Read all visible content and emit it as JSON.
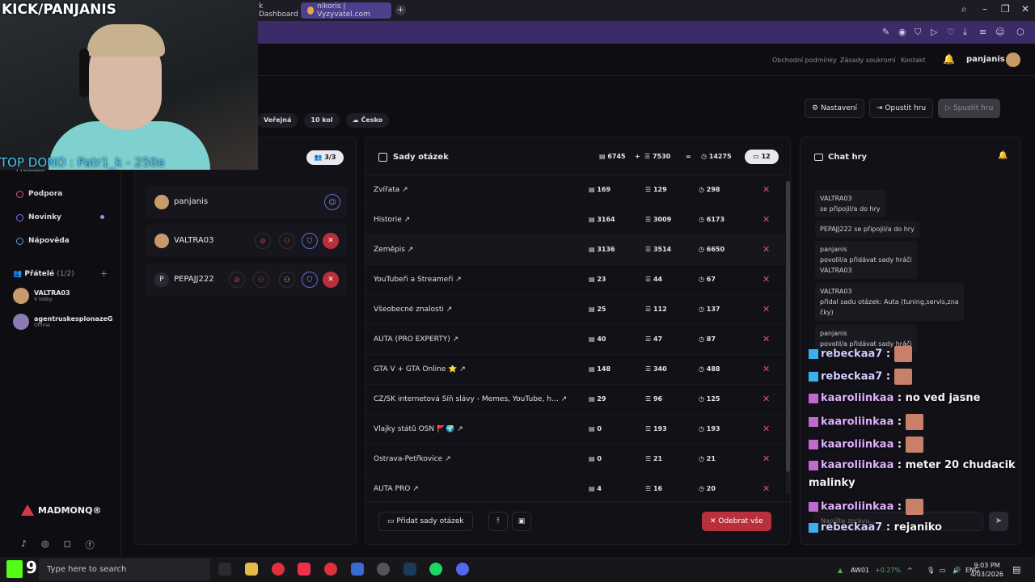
{
  "browser": {
    "tab1": "k Dashboard",
    "tab2": "nikoris | Vyzyvatel.com",
    "new_tab": "+"
  },
  "nav": {
    "links": [
      "Obchodní podmínky",
      "Zásady soukromí",
      "Kontakt"
    ],
    "username": "panjanis"
  },
  "game": {
    "visibility": "Veřejná",
    "rounds": "10 kol",
    "language": "Česko",
    "settings_label": "Nastavení",
    "leave_label": "Opustit hru",
    "start_label": "Spustit hru"
  },
  "sidebar": {
    "premium": "Premium",
    "items": [
      "Podpora",
      "Novinky",
      "Nápověda"
    ],
    "friends_label": "Přátelé",
    "friends_count": "(1/2)",
    "friends": [
      {
        "name": "VALTRA03",
        "status": "V lobby"
      },
      {
        "name": "agentruskespionazeG",
        "status": "Offline"
      }
    ],
    "brand": "MADMONQ®"
  },
  "players": {
    "count": "3/3",
    "list": [
      {
        "name": "panjanis",
        "initial": ""
      },
      {
        "name": "VALTRA03",
        "initial": ""
      },
      {
        "name": "PEPAJJ222",
        "initial": "P"
      }
    ]
  },
  "question_sets": {
    "title": "Sady otázek",
    "total_a": "6745",
    "plus": "+",
    "total_b": "7530",
    "equals": "=",
    "total_sum": "14275",
    "count": "12",
    "rows": [
      {
        "name": "Zvířata",
        "a": "169",
        "b": "129",
        "c": "298"
      },
      {
        "name": "Historie",
        "a": "3164",
        "b": "3009",
        "c": "6173"
      },
      {
        "name": "Zeměpis",
        "a": "3136",
        "b": "3514",
        "c": "6650"
      },
      {
        "name": "YouTubeři a Streameři",
        "a": "23",
        "b": "44",
        "c": "67"
      },
      {
        "name": "Všeobecné znalosti",
        "a": "25",
        "b": "112",
        "c": "137"
      },
      {
        "name": "AUTA (PRO EXPERTY)",
        "a": "40",
        "b": "47",
        "c": "87"
      },
      {
        "name": "GTA V + GTA Online ⭐",
        "a": "148",
        "b": "340",
        "c": "488"
      },
      {
        "name": "CZ/SK internetová Síň slávy - Memes, YouTube, h…",
        "a": "29",
        "b": "96",
        "c": "125"
      },
      {
        "name": "Vlajky států OSN 🚩🌍",
        "a": "0",
        "b": "193",
        "c": "193"
      },
      {
        "name": "Ostrava-Petřkovice",
        "a": "0",
        "b": "21",
        "c": "21"
      },
      {
        "name": "AUTA PRO",
        "a": "4",
        "b": "16",
        "c": "20"
      }
    ],
    "add_label": "Přidat sady otázek",
    "remove_all_label": "Odebrat vše"
  },
  "chat": {
    "title": "Chat hry",
    "messages": [
      "VALTRA03\nse připojil/a do hry",
      "PEPAJJ222 se připojil/a do hry",
      "panjanis\npovolil/a přidávat sady hráči\nVALTRA03",
      "VALTRA03\npřidal sadu otázek: Auta (tuning,servis,zna\nčky)",
      "panjanis\npovolil/a přidávat sady hráči"
    ],
    "input_placeholder": "Napište zprávu..."
  },
  "stream": {
    "tag": "KICK/PANJANIS",
    "top_dono": "TOP DONO : Patr1_k - 250e",
    "chat": [
      {
        "user": "rebeckaa7",
        "text": ""
      },
      {
        "user": "rebeckaa7",
        "text": ""
      },
      {
        "user": "kaaroliinkaa",
        "text": "no ved jasne"
      },
      {
        "user": "kaaroliinkaa",
        "text": ""
      },
      {
        "user": "kaaroliinkaa",
        "text": ""
      },
      {
        "user": "kaaroliinkaa",
        "text": "meter 20 chudacik"
      },
      {
        "user": "",
        "text": "malinky"
      },
      {
        "user": "kaaroliinkaa",
        "text": ""
      },
      {
        "user": "rebeckaa7",
        "text": "rejaniko"
      }
    ],
    "kick_count": "9"
  },
  "taskbar": {
    "search_placeholder": "Type here to search",
    "ticker": "AW01",
    "ticker_change": "+0.27%",
    "lang": "ENG",
    "time": "9:03 PM",
    "date": "4/03/2026"
  },
  "colors": {
    "accent": "#7c6ff0",
    "danger": "#e05560",
    "kick_green": "#53fc18"
  }
}
